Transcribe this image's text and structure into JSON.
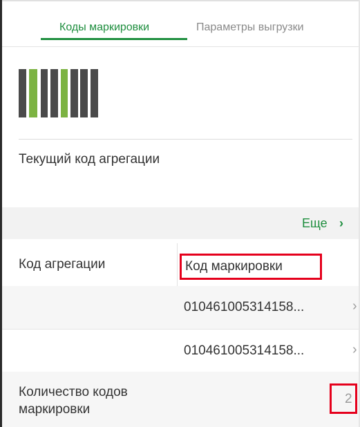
{
  "tabs": [
    {
      "label": "Коды маркировки",
      "active": true
    },
    {
      "label": "Параметры выгрузки",
      "active": false
    }
  ],
  "barcode_icon": "barcode-icon",
  "current_code": {
    "label": "Текущий код агрегации"
  },
  "more": {
    "label": "Еще",
    "icon": "chevron-right-icon"
  },
  "table": {
    "columns": [
      "Код агрегации",
      "Код маркировки"
    ],
    "rows": [
      {
        "aggregation_code": "",
        "marking_code": "010461005314158...",
        "icon": "chevron-right-icon"
      },
      {
        "aggregation_code": "",
        "marking_code": "010461005314158...",
        "icon": "chevron-right-icon"
      }
    ]
  },
  "count": {
    "label": "Количество кодов маркировки",
    "value": "2"
  },
  "colors": {
    "accent": "#1e8e3e",
    "highlight": "#e5001c",
    "barcode_dark": "#4a4a4a",
    "barcode_light": "#7cb342"
  }
}
